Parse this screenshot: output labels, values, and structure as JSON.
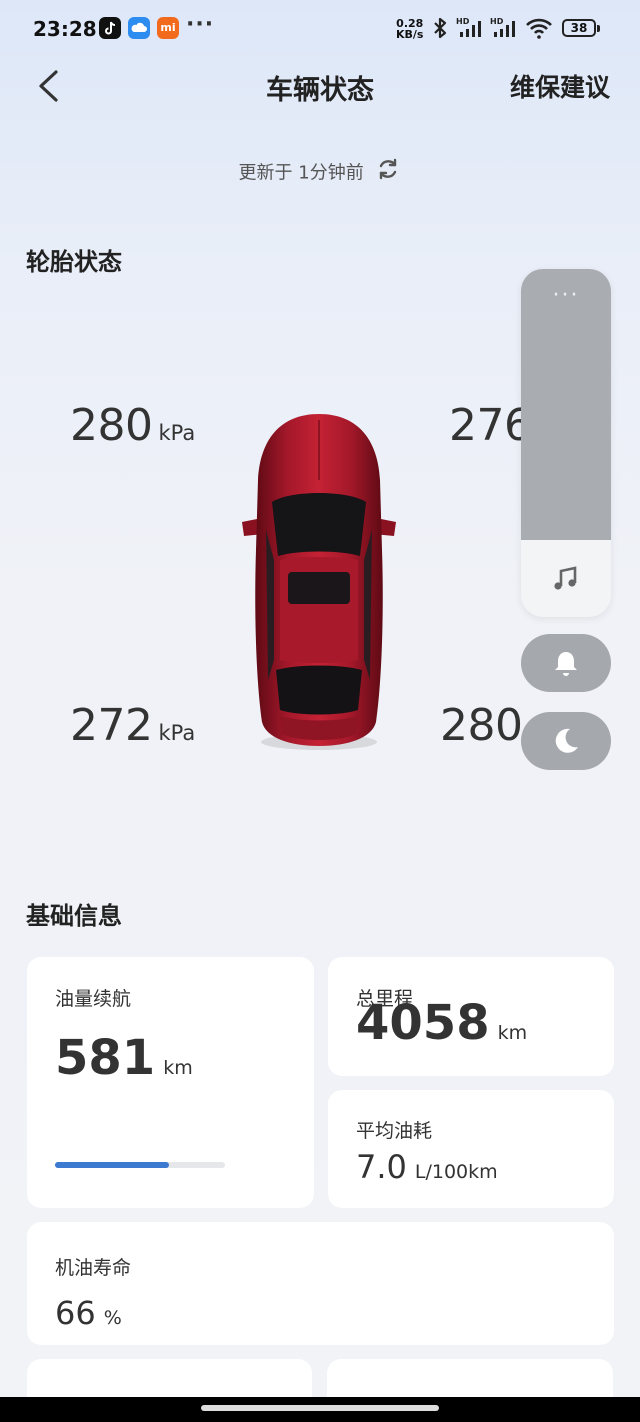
{
  "status_bar": {
    "time": "23:28",
    "dots": "···",
    "net_speed_value": "0.28",
    "net_speed_unit": "KB/s",
    "battery": "38",
    "app_icons": [
      "tiktok-icon",
      "cloud-icon",
      "mi-icon"
    ],
    "mi_label": "mi"
  },
  "header": {
    "title": "车辆状态",
    "right_link": "维保建议"
  },
  "updated_text": "更新于 1分钟前",
  "tire_section": {
    "title": "轮胎状态",
    "front_left": {
      "value": "280",
      "unit": "kPa"
    },
    "front_right": {
      "value": "276",
      "unit": ""
    },
    "rear_left": {
      "value": "272",
      "unit": "kPa"
    },
    "rear_right": {
      "value": "280",
      "unit": ""
    },
    "car_color": "#9e1626"
  },
  "floating_panel": {
    "menu": "···",
    "icons": [
      "music-icon",
      "bell-icon",
      "moon-icon"
    ]
  },
  "basic_info": {
    "title": "基础信息",
    "fuel_range": {
      "label": "油量续航",
      "value": "581",
      "unit": "km",
      "progress_fraction": 0.67
    },
    "odometer": {
      "label": "总里程",
      "value": "4058",
      "unit": "km"
    },
    "avg_consumption": {
      "label": "平均油耗",
      "value": "7.0",
      "unit": "L/100km"
    },
    "oil_life": {
      "label": "机油寿命",
      "value": "66",
      "unit": "%"
    }
  },
  "colors": {
    "accent": "#3b7ad0",
    "panel_grey": "#a9acb1"
  }
}
